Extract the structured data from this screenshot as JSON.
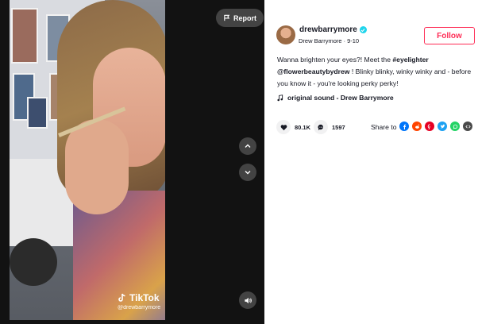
{
  "player": {
    "report_label": "Report",
    "watermark_logo": "TikTok",
    "watermark_handle": "@drewbarrymore"
  },
  "author": {
    "username": "drewbarrymore",
    "display_name": "Drew Barrymore",
    "separator": "·",
    "date": "9-10",
    "follow_label": "Follow"
  },
  "caption": {
    "text_1": "Wanna brighten your eyes?! Meet the ",
    "hashtag": "#eyelighter",
    "mention": "@flowerbeautybydrew",
    "text_2": " ! Blinky blinky, winky winky and - before you know it - you're looking perky perky!"
  },
  "sound": {
    "label": "original sound - Drew Barrymore"
  },
  "stats": {
    "likes": "80.1K",
    "comments": "1597"
  },
  "share": {
    "label": "Share to",
    "targets": [
      "facebook",
      "reddit",
      "pinterest",
      "twitter",
      "whatsapp",
      "embed"
    ]
  },
  "colors": {
    "accent": "#fe2c55",
    "verified": "#20d5ec",
    "facebook": "#0075fa",
    "reddit": "#ff4500",
    "pinterest": "#e60023",
    "twitter": "#1da1f2",
    "whatsapp": "#25d366",
    "embed": "#4a4a4a"
  },
  "icons": {
    "report": "flag-icon",
    "nav_up": "chevron-up-icon",
    "nav_down": "chevron-down-icon",
    "volume": "volume-icon",
    "music": "music-note-icon",
    "like": "heart-icon",
    "comment": "comment-icon",
    "verified": "verified-badge-icon"
  }
}
